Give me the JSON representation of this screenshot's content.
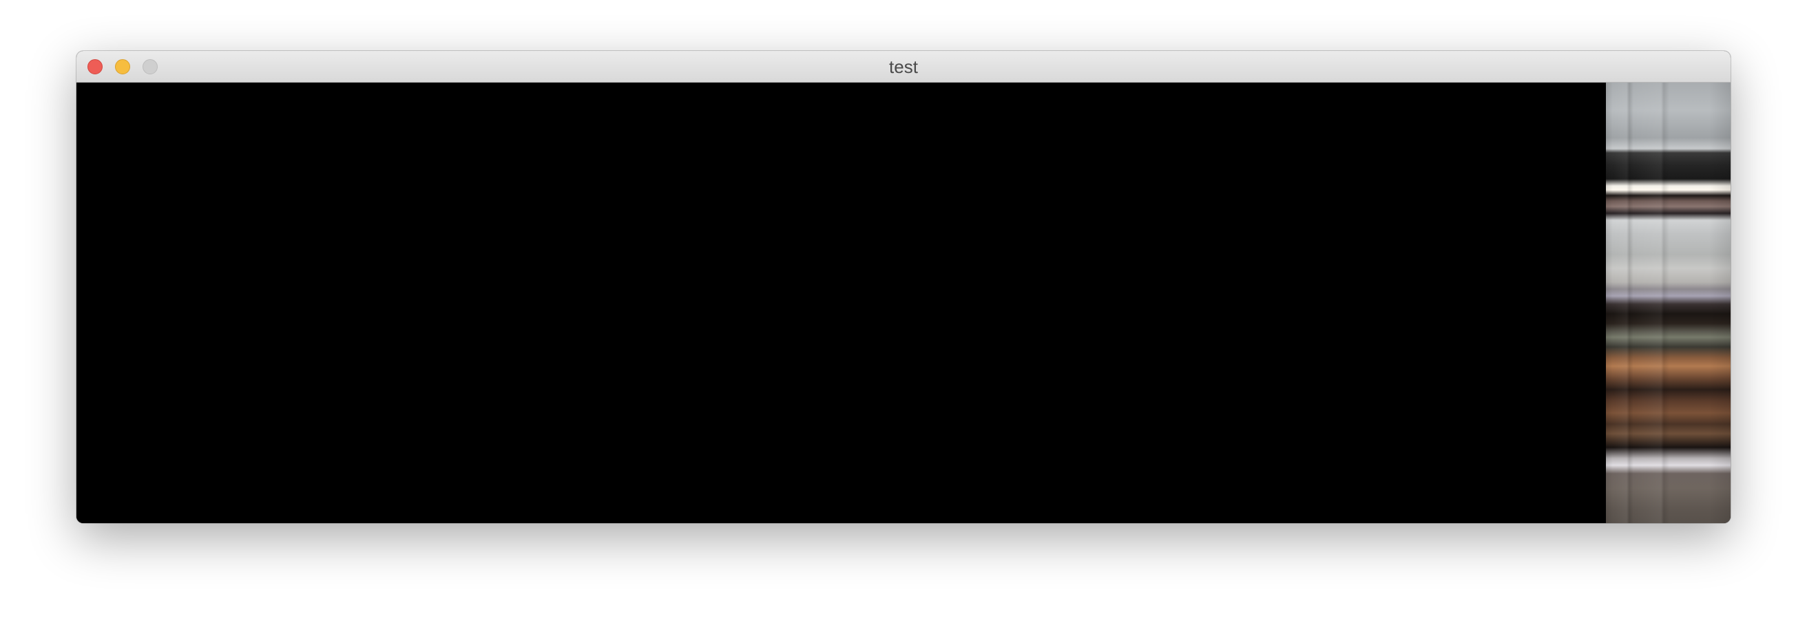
{
  "window": {
    "title": "test"
  },
  "titlebar": {
    "buttons": {
      "close": {
        "icon": "close-circle-icon",
        "color": "#ee5d56"
      },
      "minimize": {
        "icon": "minimize-circle-icon",
        "color": "#f6bd3f"
      },
      "zoom": {
        "icon": "zoom-circle-icon",
        "color": "#cfcfcf"
      }
    }
  },
  "content": {
    "background_color": "#000000"
  }
}
